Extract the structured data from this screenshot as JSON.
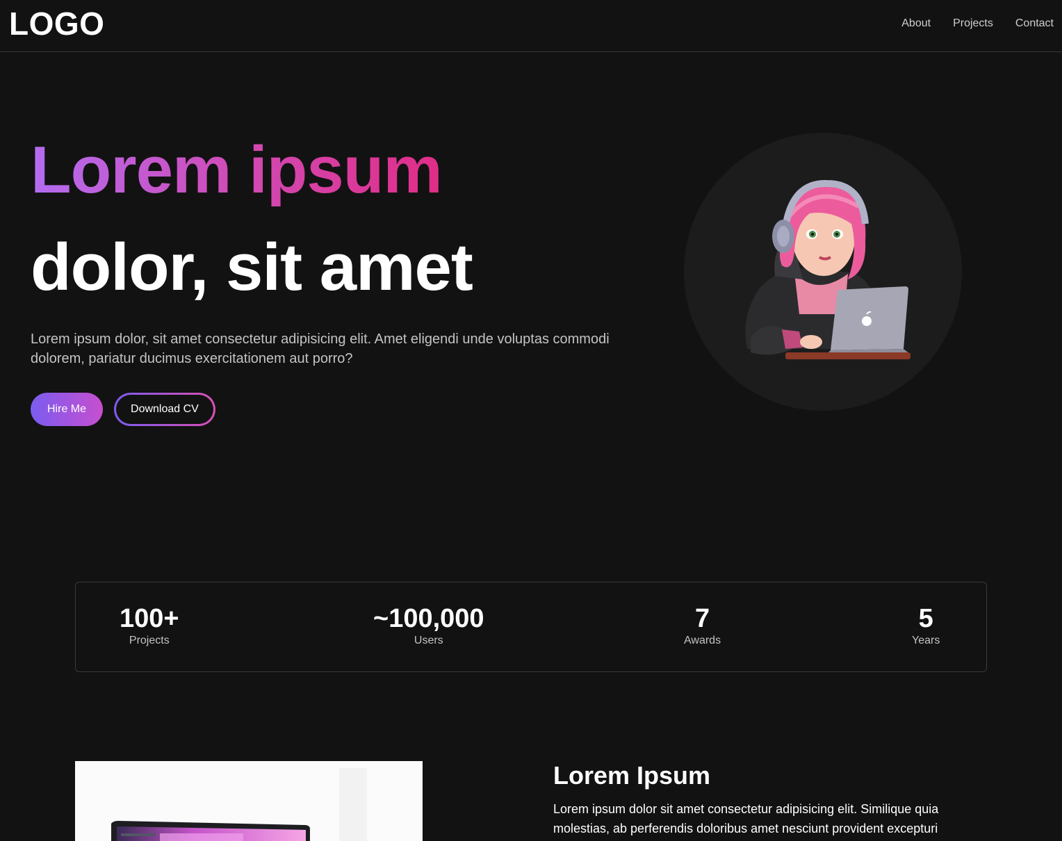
{
  "nav": {
    "logo": "LOGO",
    "links": [
      "About",
      "Projects",
      "Contact"
    ]
  },
  "hero": {
    "title_line1": "Lorem ipsum",
    "title_line2": "dolor, sit amet",
    "description": "Lorem ipsum dolor, sit amet consectetur adipisicing elit. Amet eligendi unde voluptas commodi dolorem, pariatur ducimus exercitationem aut porro?",
    "hire_label": "Hire Me",
    "cv_label": "Download CV"
  },
  "stats": [
    {
      "value": "100+",
      "label": "Projects"
    },
    {
      "value": "~100,000",
      "label": "Users"
    },
    {
      "value": "7",
      "label": "Awards"
    },
    {
      "value": "5",
      "label": "Years"
    }
  ],
  "about": {
    "title": "Lorem Ipsum",
    "text": "Lorem ipsum dolor sit amet consectetur adipisicing elit. Similique quia molestias, ab perferendis doloribus amet nesciunt provident excepturi"
  },
  "colors": {
    "background": "#121212",
    "accent_purple": "#7b5cf0",
    "accent_pink": "#e02d86"
  }
}
